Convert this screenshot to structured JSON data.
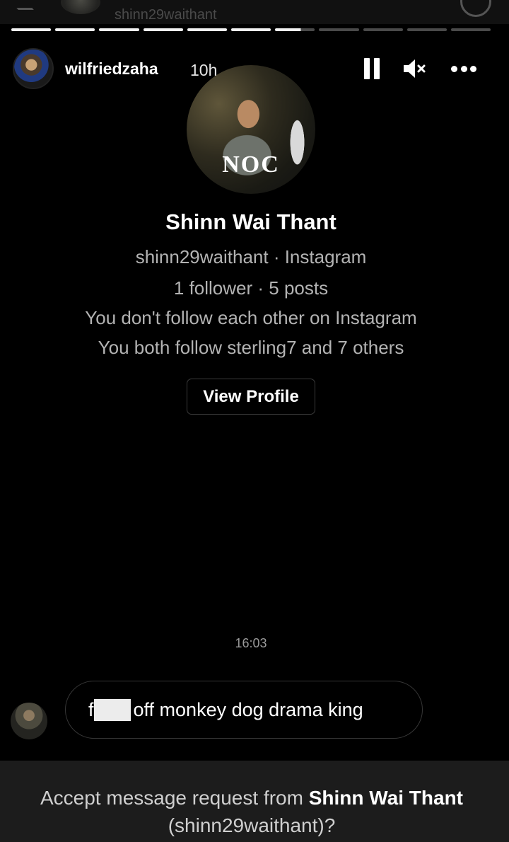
{
  "top_overlay": {
    "partial_name": "shinn29waithant"
  },
  "story": {
    "progress": {
      "segments": 11,
      "completed": 6,
      "current_fraction": 0.65
    },
    "username": "wilfriedzaha",
    "time": "10h",
    "icons": {
      "pause": "pause-icon",
      "mute": "speaker-mute-icon",
      "more": "more-dots-icon"
    }
  },
  "profile": {
    "photo_logo": "NOC",
    "display_name": "Shinn Wai Thant",
    "handle_line": "shinn29waithant · Instagram",
    "stats_line": "1 follower · 5 posts",
    "follow_status": "You don't follow each other on Instagram",
    "mutual_line": "You both follow sterling7 and 7 others",
    "view_profile_label": "View Profile"
  },
  "conversation": {
    "timestamp": "16:03",
    "message": {
      "prefix": "f",
      "rest": "off monkey dog drama king"
    }
  },
  "request": {
    "prefix": "Accept message request from ",
    "name": "Shinn Wai Thant",
    "handle": "(shinn29waithant)?"
  },
  "colors": {
    "background": "#000000",
    "muted_text": "#b3b3b3",
    "request_bar": "#1c1c1c"
  }
}
